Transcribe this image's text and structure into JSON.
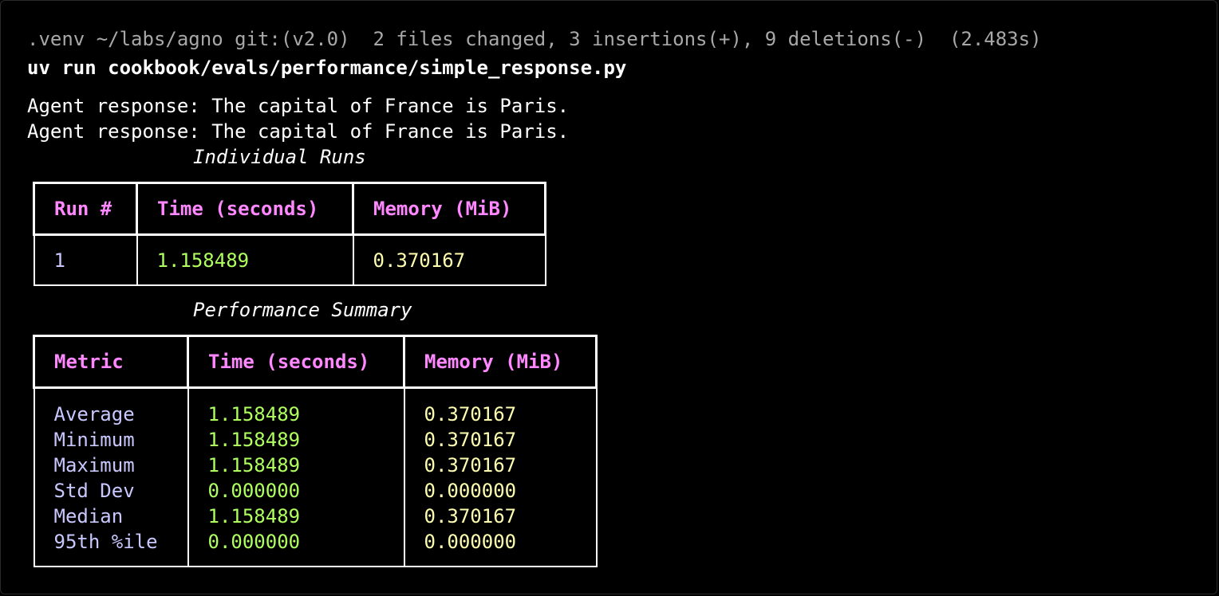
{
  "terminal": {
    "prompt_line": ".venv ~/labs/agno git:(v2.0)  2 files changed, 3 insertions(+), 9 deletions(-)  (2.483s)",
    "command": "uv run cookbook/evals/performance/simple_response.py",
    "output_lines": [
      "Agent response: The capital of France is Paris.",
      "Agent response: The capital of France is Paris."
    ]
  },
  "individual_runs": {
    "title": "Individual Runs",
    "headers": [
      "Run #",
      "Time (seconds)",
      "Memory (MiB)"
    ],
    "rows": [
      [
        "1",
        "1.158489",
        "0.370167"
      ]
    ]
  },
  "performance_summary": {
    "title": "Performance Summary",
    "headers": [
      "Metric",
      "Time (seconds)",
      "Memory (MiB)"
    ],
    "rows": [
      [
        "Average",
        "1.158489",
        "0.370167"
      ],
      [
        "Minimum",
        "1.158489",
        "0.370167"
      ],
      [
        "Maximum",
        "1.158489",
        "0.370167"
      ],
      [
        "Std Dev",
        "0.000000",
        "0.000000"
      ],
      [
        "Median",
        "1.158489",
        "0.370167"
      ],
      [
        "95th %ile",
        "0.000000",
        "0.000000"
      ]
    ]
  },
  "colors": {
    "background": "#000000",
    "header_text": "#ff87ff",
    "metric_text": "#c8c8ff",
    "time_text": "#afff5f",
    "memory_text": "#ffffaf",
    "prompt_text": "#a8a8a8"
  }
}
